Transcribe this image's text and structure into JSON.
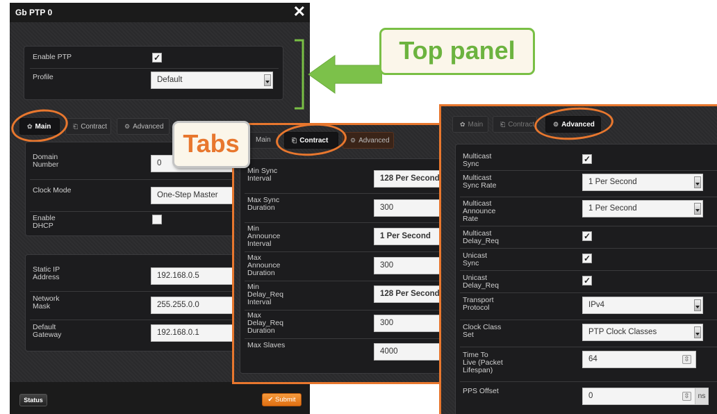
{
  "dialog": {
    "title": "Gb PTP 0",
    "close_glyph": "✕",
    "top_panel": {
      "enable_ptp_label": "Enable PTP",
      "enable_ptp_checked": true,
      "profile_label": "Profile",
      "profile_value": "Default"
    },
    "tabs": [
      {
        "label": "Main",
        "icon": "gear-icon",
        "glyph": "✿"
      },
      {
        "label": "Contract",
        "icon": "contract-icon",
        "glyph": "⎗"
      },
      {
        "label": "Advanced",
        "icon": "gears-icon",
        "glyph": "⚙"
      }
    ],
    "main": {
      "domain_label": "Domain\nNumber",
      "domain_value": "0",
      "clock_mode_label": "Clock Mode",
      "clock_mode_value": "One-Step Master",
      "dhcp_label": "Enable\nDHCP",
      "dhcp_checked": false,
      "ip_label": "Static IP\nAddress",
      "ip_value": "192.168.0.5",
      "mask_label": "Network\nMask",
      "mask_value": "255.255.0.0",
      "gateway_label": "Default\nGateway",
      "gateway_value": "192.168.0.1"
    },
    "footer": {
      "status_label": "Status",
      "submit_label": "✔ Submit"
    }
  },
  "contract": {
    "rows": [
      {
        "label": "Min Sync\nInterval",
        "value": "128 Per Second",
        "bold": true
      },
      {
        "label": "Max Sync\nDuration",
        "value": "300",
        "bold": false
      },
      {
        "label": "Min\nAnnounce\nInterval",
        "value": "1 Per Second",
        "bold": true
      },
      {
        "label": "Max\nAnnounce\nDuration",
        "value": "300",
        "bold": false
      },
      {
        "label": "Min\nDelay_Req\nInterval",
        "value": "128 Per Second",
        "bold": true
      },
      {
        "label": "Max\nDelay_Req\nDuration",
        "value": "300",
        "bold": false
      },
      {
        "label": "Max Slaves",
        "value": "4000",
        "bold": false
      }
    ]
  },
  "advanced": {
    "rows": [
      {
        "label": "Multicast\nSync",
        "type": "check",
        "checked": true
      },
      {
        "label": "Multicast\nSync Rate",
        "type": "select",
        "value": "1 Per Second"
      },
      {
        "label": "Multicast\nAnnounce\nRate",
        "type": "select",
        "value": "1 Per Second"
      },
      {
        "label": "Multicast\nDelay_Req",
        "type": "check",
        "checked": true
      },
      {
        "label": "Unicast\nSync",
        "type": "check",
        "checked": true
      },
      {
        "label": "Unicast\nDelay_Req",
        "type": "check",
        "checked": true
      },
      {
        "label": "Transport\nProtocol",
        "type": "select",
        "value": "IPv4"
      },
      {
        "label": "Clock Class\nSet",
        "type": "select",
        "value": "PTP Clock Classes"
      },
      {
        "label": "Time To\nLive (Packet\nLifespan)",
        "type": "spin",
        "value": "64"
      },
      {
        "label": "PPS Offset",
        "type": "spin",
        "value": "0",
        "unit": "ns"
      }
    ]
  },
  "callouts": {
    "top_panel": "Top panel",
    "tabs": "Tabs"
  },
  "colors": {
    "accent_orange": "#e8772e",
    "callout_green": "#6cb33f"
  }
}
